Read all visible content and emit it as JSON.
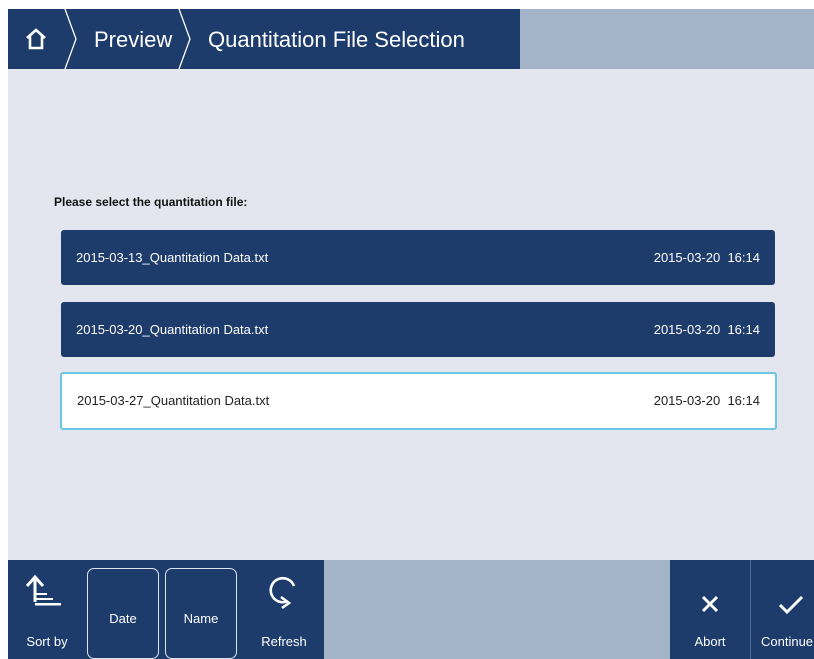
{
  "header": {
    "breadcrumb": [
      "Preview",
      "Quantitation File Selection"
    ]
  },
  "main": {
    "prompt": "Please select the quantitation file:",
    "files": [
      {
        "name": "2015-03-13_Quantitation Data.txt",
        "date": "2015-03-20",
        "time": "16:14",
        "selected": false
      },
      {
        "name": "2015-03-20_Quantitation Data.txt",
        "date": "2015-03-20",
        "time": "16:14",
        "selected": false
      },
      {
        "name": "2015-03-27_Quantitation Data.txt",
        "date": "2015-03-20",
        "time": "16:14",
        "selected": true
      }
    ]
  },
  "toolbar": {
    "sort_by": "Sort by",
    "sort_options": [
      "Date",
      "Name"
    ],
    "refresh": "Refresh",
    "abort": "Abort",
    "continue": "Continue"
  },
  "icons": {
    "home": "home-icon",
    "sort": "sort-ascending-icon",
    "refresh": "refresh-icon",
    "abort": "close-icon",
    "continue": "checkmark-icon"
  },
  "colors": {
    "primary": "#1d3c6b",
    "background": "#e3e6ef",
    "filler": "#a3b3c8",
    "selection_border": "#6ec6e6"
  }
}
